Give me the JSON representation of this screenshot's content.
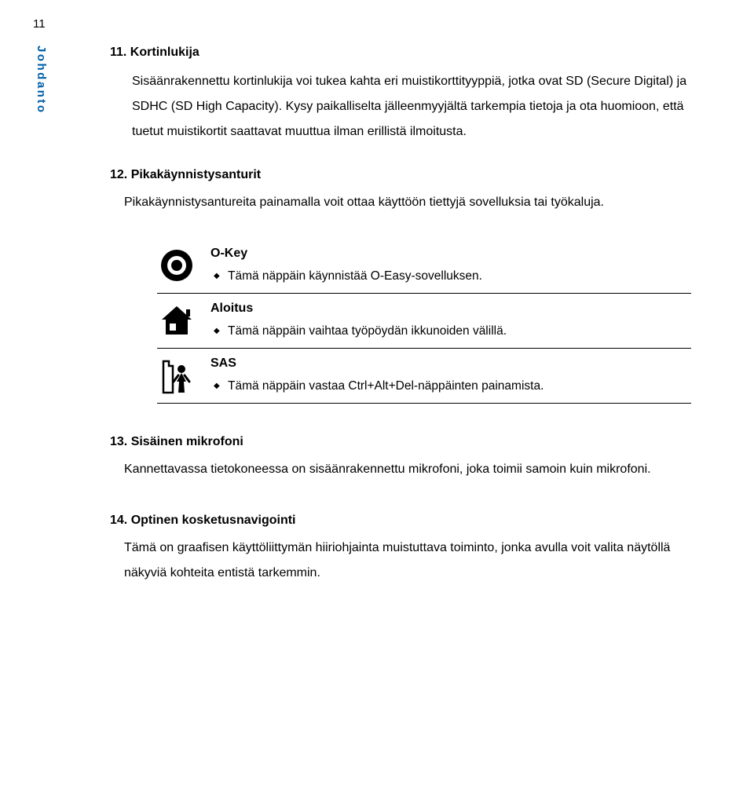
{
  "page_number": "11",
  "side_tab": "Johdanto",
  "section11": {
    "title": "11. Kortinlukija",
    "para": "Sisäänrakennettu kortinlukija voi tukea kahta eri muistikorttityyppiä, jotka ovat SD (Secure Digital) ja SDHC (SD High Capacity). Kysy paikalliselta jälleenmyyjältä tarkempia tietoja ja ota huomioon, että tuetut muistikortit saattavat muuttua ilman erillistä ilmoitusta."
  },
  "section12": {
    "title": "12. Pikakäynnistysanturit",
    "para": "Pikakäynnistysantureita painamalla voit ottaa käyttöön tiettyjä sovelluksia tai työkaluja."
  },
  "keys": [
    {
      "title": "O-Key",
      "desc": "Tämä näppäin käynnistää O-Easy-sovelluksen."
    },
    {
      "title": "Aloitus",
      "desc": "Tämä näppäin vaihtaa työpöydän ikkunoiden välillä."
    },
    {
      "title": "SAS",
      "desc": "Tämä näppäin vastaa Ctrl+Alt+Del-näppäinten painamista."
    }
  ],
  "section13": {
    "title": "13. Sisäinen mikrofoni",
    "para": "Kannettavassa tietokoneessa on sisäänrakennettu mikrofoni, joka toimii samoin kuin mikrofoni."
  },
  "section14": {
    "title": "14. Optinen kosketusnavigointi",
    "para": "Tämä on graafisen käyttöliittymän hiiriohjainta muistuttava toiminto, jonka avulla voit valita näytöllä näkyviä kohteita entistä tarkemmin."
  }
}
